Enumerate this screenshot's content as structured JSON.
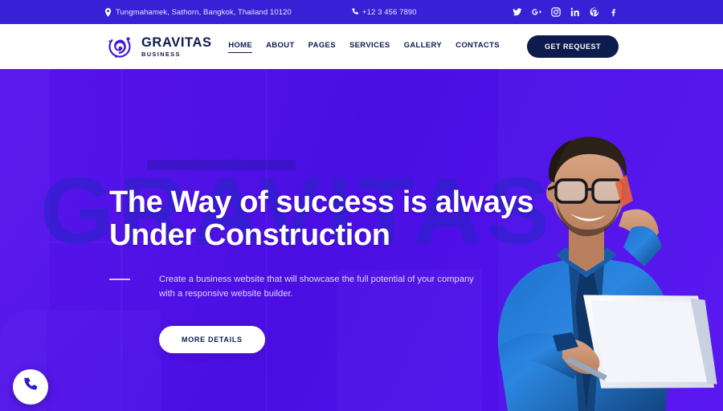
{
  "topbar": {
    "address": "Tungmahamek, Sathorn, Bangkok, Thailand 10120",
    "address_icon": "map-pin-icon",
    "phone": "+12 3 456 7890",
    "phone_icon": "phone-icon",
    "social": [
      {
        "name": "twitter-icon",
        "glyph": "t"
      },
      {
        "name": "google-plus-icon",
        "glyph": "G+"
      },
      {
        "name": "instagram-icon",
        "glyph": "ig"
      },
      {
        "name": "linkedin-icon",
        "glyph": "in"
      },
      {
        "name": "pinterest-icon",
        "glyph": "P"
      },
      {
        "name": "facebook-icon",
        "glyph": "f"
      }
    ],
    "bg_color": "#3621D6"
  },
  "header": {
    "logo_icon": "gravitas-swirl-logo-icon",
    "brand_name": "GRAVITAS",
    "brand_sub": "BUSINESS",
    "nav": [
      {
        "label": "HOME",
        "active": true
      },
      {
        "label": "ABOUT",
        "active": false
      },
      {
        "label": "PAGES",
        "active": false
      },
      {
        "label": "SERVICES",
        "active": false
      },
      {
        "label": "GALLERY",
        "active": false
      },
      {
        "label": "CONTACTS",
        "active": false
      }
    ],
    "cta_label": "GET REQUEST",
    "cta_color": "#0E1B4D",
    "text_color": "#0E1B4D"
  },
  "hero": {
    "watermark": "GRAVITAS",
    "watermark_color": "#2A23C9",
    "headline_line1": "The Way of success is always",
    "headline_line2": "Under Construction",
    "subtitle": "Create a business website that will showcase the full potential of your company with a responsive website builder.",
    "button_label": "MORE DETAILS",
    "bg_color": "#4A12E6",
    "image_alt": "businessman-with-phone-and-documents"
  },
  "floating": {
    "call_button_icon": "phone-icon"
  }
}
